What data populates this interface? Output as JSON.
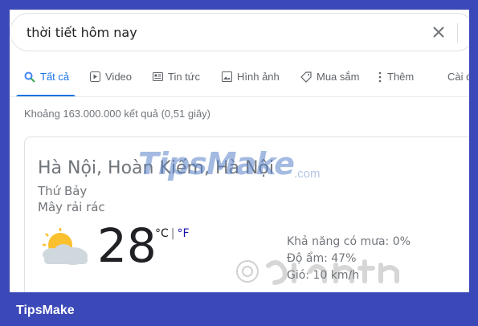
{
  "search": {
    "query": "thời tiết hôm nay"
  },
  "tabs": [
    {
      "label": "Tất cả",
      "icon": "search-icon"
    },
    {
      "label": "Video",
      "icon": "play-icon"
    },
    {
      "label": "Tin tức",
      "icon": "news-icon"
    },
    {
      "label": "Hình ảnh",
      "icon": "image-icon"
    },
    {
      "label": "Mua sắm",
      "icon": "tag-icon"
    },
    {
      "label": "Thêm",
      "icon": "more-vert-icon"
    },
    {
      "label": "Cài đ"
    }
  ],
  "result_stats": "Khoảng 163.000.000 kết quả (0,51 giây)",
  "weather": {
    "location": "Hà Nội, Hoàn Kiếm, Hà Nội",
    "day": "Thứ Bảy",
    "condition": "Mây rải rác",
    "temperature": "28",
    "unit_c": "°C",
    "unit_sep": "|",
    "unit_f": "°F",
    "rain_chance": "Khả năng có mưa: 0%",
    "humidity": "Độ ẩm: 47%",
    "wind": "Gió: 10 km/h"
  },
  "watermark": {
    "text": "TipsMake",
    "domain": ".com"
  },
  "footer": {
    "brand": "TipsMake"
  },
  "colors": {
    "background": "#3b49b8",
    "accent": "#1a73e8"
  }
}
